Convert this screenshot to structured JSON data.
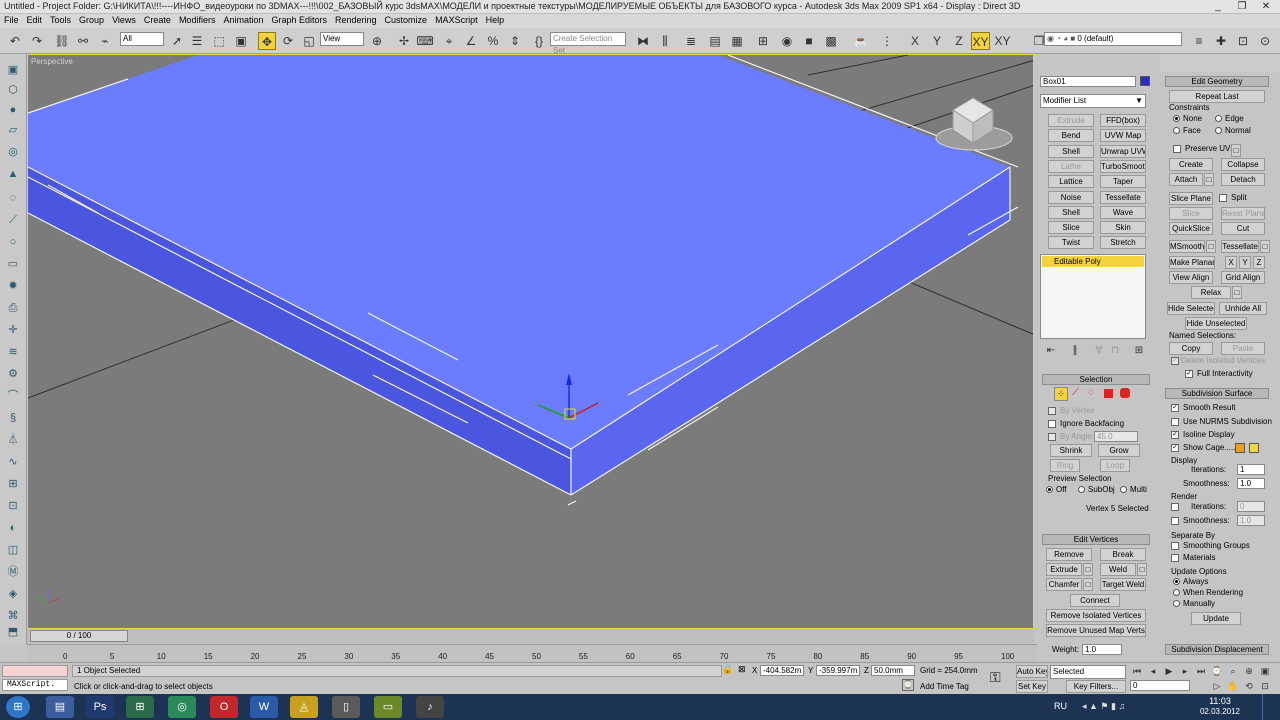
{
  "title": {
    "text": "Untitled     - Project Folder: G:\\НИКИТА\\!!!----ИНФО_видеоуроки по 3DMAX---!!!\\002_БАЗОВЫЙ курс 3dsMAX\\МОДЕЛИ и проектные текстуры\\МОДЕЛИРУЕМЫЕ ОБЪЕКТЫ для БАЗОВОГО курса     - Autodesk 3ds Max  2009 SP1  x64      - Display : Direct 3D"
  },
  "menu": [
    "File",
    "Edit",
    "Tools",
    "Group",
    "Views",
    "Create",
    "Modifiers",
    "Animation",
    "Graph Editors",
    "Rendering",
    "Customize",
    "MAXScript",
    "Help"
  ],
  "toolbar": {
    "filter": "All",
    "refcoord": "View",
    "selset": "Create Selection Set",
    "axis": [
      "X",
      "Y",
      "Z",
      "XY",
      "XY"
    ],
    "layer": "0 (default)"
  },
  "viewport": {
    "label": "Perspective"
  },
  "command_panel": {
    "object_name": "Box01",
    "object_color": "#2a2ac8",
    "modifier_list": "Modifier List",
    "modifier_buttons": [
      [
        "Extrude",
        "FFD(box)"
      ],
      [
        "Bend",
        "UVW Map"
      ],
      [
        "Shell",
        "Unwrap UVW"
      ],
      [
        "Lathe",
        "TurboSmooth"
      ],
      [
        "Lattice",
        "Taper"
      ],
      [
        "Noise",
        "Tessellate"
      ],
      [
        "Shell",
        "Wave"
      ],
      [
        "Slice",
        "Skin"
      ],
      [
        "Twist",
        "Stretch"
      ]
    ],
    "stack_item": "Editable Poly",
    "selection": {
      "header": "Selection",
      "by_vertex": "By Vertex",
      "ignore_backfacing": "Ignore Backfacing",
      "by_angle": "By Angle:",
      "angle_value": "45.0",
      "shrink": "Shrink",
      "grow": "Grow",
      "ring": "Ring",
      "loop": "Loop",
      "preview_selection": "Preview Selection",
      "preview_options": [
        "Off",
        "SubObj",
        "Multi"
      ],
      "status": "Vertex 5 Selected"
    },
    "edit_vertices": {
      "header": "Edit Vertices",
      "remove": "Remove",
      "break": "Break",
      "extrude": "Extrude",
      "weld": "Weld",
      "chamfer": "Chamfer",
      "target_weld": "Target Weld",
      "connect": "Connect",
      "remove_isolated": "Remove Isolated Vertices",
      "remove_unused": "Remove Unused Map Verts",
      "weight_label": "Weight:",
      "weight": "1.0"
    }
  },
  "right_panel": {
    "edit_geometry": "Edit Geometry",
    "repeat_last": "Repeat Last",
    "constraints": "Constraints",
    "constraint_opts": [
      "None",
      "Edge",
      "Face",
      "Normal"
    ],
    "preserve_uvs": "Preserve UVs",
    "create": "Create",
    "collapse": "Collapse",
    "attach": "Attach",
    "detach": "Detach",
    "slice_plane": "Slice Plane",
    "split": "Split",
    "slice": "Slice",
    "reset_plane": "Reset Plane",
    "quickslice": "QuickSlice",
    "cut": "Cut",
    "msmooth": "MSmooth",
    "tessellate": "Tessellate",
    "make_planar": "Make Planar",
    "x": "X",
    "y": "Y",
    "z": "Z",
    "view_align": "View Align",
    "grid_align": "Grid Align",
    "relax": "Relax",
    "hide_selected": "Hide Selected",
    "unhide_all": "Unhide All",
    "hide_unselected": "Hide Unselected",
    "named_selections": "Named Selections:",
    "copy": "Copy",
    "paste": "Paste",
    "delete_isolated": "Delete Isolated Vertices",
    "full_interactivity": "Full Interactivity",
    "subdivision_surface": "Subdivision Surface",
    "smooth_result": "Smooth Result",
    "use_nurms": "Use NURMS Subdivision",
    "isoline": "Isoline Display",
    "show_cage": "Show Cage......",
    "display": "Display",
    "iterations": "Iterations:",
    "iter_val": "1",
    "smoothness": "Smoothness:",
    "smooth_val": "1.0",
    "render": "Render",
    "r_iter_val": "0",
    "r_smooth_val": "1.0",
    "separate_by": "Separate By",
    "smoothing_groups": "Smoothing Groups",
    "materials": "Materials",
    "update_options": "Update Options",
    "update_opts": [
      "Always",
      "When Rendering",
      "Manually"
    ],
    "update": "Update",
    "subdiv_displacement": "Subdivision Displacement",
    "cage_colors": [
      "#f29a1e",
      "#f2d53c"
    ]
  },
  "timeline": {
    "slider": "0 / 100",
    "ticks": [
      "0",
      "5",
      "10",
      "15",
      "20",
      "25",
      "30",
      "35",
      "40",
      "45",
      "50",
      "55",
      "60",
      "65",
      "70",
      "75",
      "80",
      "85",
      "90",
      "95",
      "100"
    ]
  },
  "status": {
    "maxscript": "MAXScript.",
    "selected": "1 Object Selected",
    "prompt": "Click or click-and-drag to select objects",
    "x": "-404.582m",
    "y": "-359.997m",
    "z": "50.0mm",
    "grid": "Grid = 254.0mm",
    "add_time_tag": "Add Time Tag",
    "auto_key": "Auto Key",
    "set_key": "Set Key",
    "selected_filter": "Selected",
    "key_filters": "Key Filters...",
    "frame": "0"
  },
  "taskbar": {
    "lang": "RU",
    "time": "11:03",
    "date": "02.03.2012"
  }
}
